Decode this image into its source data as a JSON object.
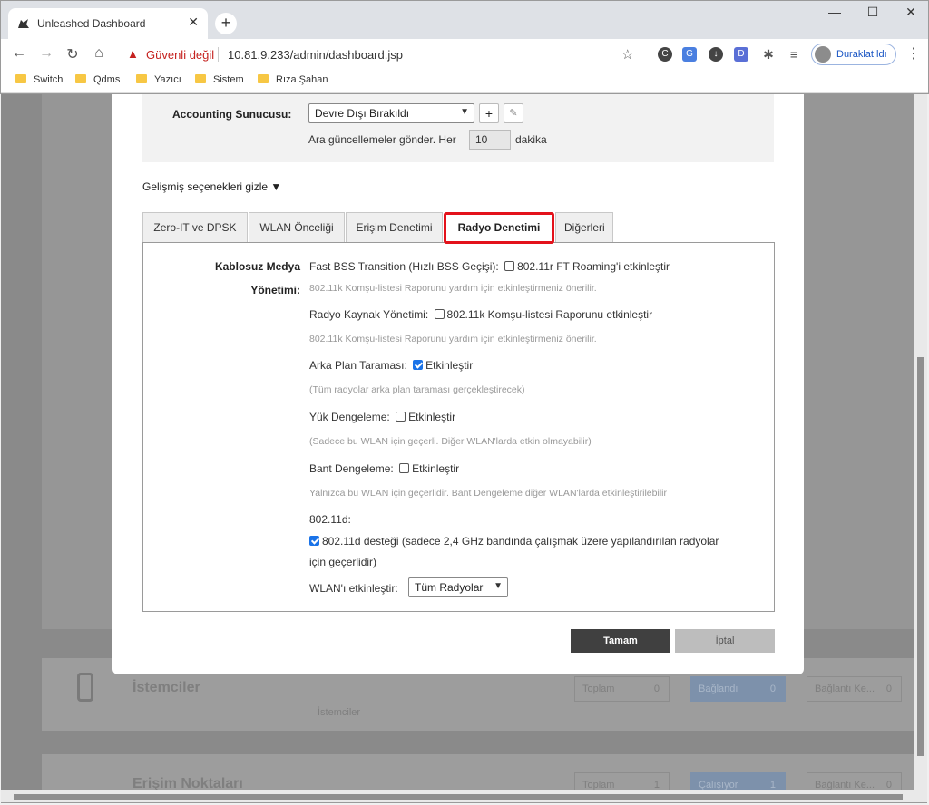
{
  "browser": {
    "tab_title": "Unleashed Dashboard",
    "security_warning": "Güvenli değil",
    "url": "10.81.9.233/admin/dashboard.jsp",
    "profile_label": "Duraklatıldı",
    "bookmarks": [
      "Switch",
      "Qdms",
      "Yazıcı",
      "Sistem",
      "Rıza Şahan"
    ]
  },
  "background": {
    "clients_title": "İstemciler",
    "clients_sub": "İstemciler",
    "clients_total_label": "Toplam",
    "clients_total_value": "0",
    "clients_connected_label": "Bağlandı",
    "clients_connected_value": "0",
    "clients_disconnected_label": "Bağlantı Ke...",
    "clients_disconnected_value": "0",
    "ap_title": "Erişim Noktaları",
    "ap_total_label": "Toplam",
    "ap_total_value": "1",
    "ap_running_label": "Çalışıyor",
    "ap_running_value": "1",
    "ap_disconnected_label": "Bağlantı Ke...",
    "ap_disconnected_value": "0"
  },
  "dialog": {
    "accounting_label": "Accounting Sunucusu:",
    "accounting_value": "Devre Dışı Bırakıldı",
    "add_symbol": "+",
    "edit_symbol": "✎",
    "update_prefix": "Ara güncellemeler gönder. Her",
    "update_value": "10",
    "update_suffix": "dakika",
    "advanced_toggle": "Gelişmiş seçenekleri gizle ▼",
    "tabs": [
      "Zero-IT ve DPSK",
      "WLAN Önceliği",
      "Erişim Denetimi",
      "Radyo Denetimi",
      "Diğerleri"
    ],
    "active_tab": "Radyo Denetimi",
    "section_label_1": "Kablosuz Medya",
    "section_label_2": "Yönetimi:",
    "fbt_prefix": "Fast BSS Transition (Hızlı BSS Geçişi):",
    "fbt_checkbox": "802.11r FT Roaming'i etkinleştir",
    "fbt_hint": "802.11k Komşu-listesi Raporunu yardım için etkinleştirmeniz önerilir.",
    "rrm_prefix": "Radyo Kaynak Yönetimi:",
    "rrm_checkbox": "802.11k Komşu-listesi Raporunu etkinleştir",
    "rrm_hint": "802.11k Komşu-listesi Raporunu yardım için etkinleştirmeniz önerilir.",
    "bg_scan_prefix": "Arka Plan Taraması:",
    "bg_scan_checkbox": "Etkinleştir",
    "bg_scan_hint": "(Tüm radyolar arka plan taraması gerçekleştirecek)",
    "load_bal_prefix": "Yük Dengeleme:",
    "load_bal_checkbox": "Etkinleştir",
    "load_bal_hint": "(Sadece bu WLAN için geçerli. Diğer WLAN'larda etkin olmayabilir)",
    "band_bal_prefix": "Bant Dengeleme:",
    "band_bal_checkbox": "Etkinleştir",
    "band_bal_hint": "Yalnızca bu WLAN için geçerlidir. Bant Dengeleme diğer WLAN'larda etkinleştirilebilir",
    "dot11d_label": "802.11d:",
    "dot11d_checkbox_line1": "802.11d desteği (sadece 2,4 GHz bandında çalışmak üzere yapılandırılan radyolar",
    "dot11d_checkbox_line2": "için geçerlidir)",
    "wlan_enable_label": "WLAN'ı etkinleştir:",
    "wlan_enable_value": "Tüm Radyolar",
    "ok_button": "Tamam",
    "cancel_button": "İptal"
  }
}
